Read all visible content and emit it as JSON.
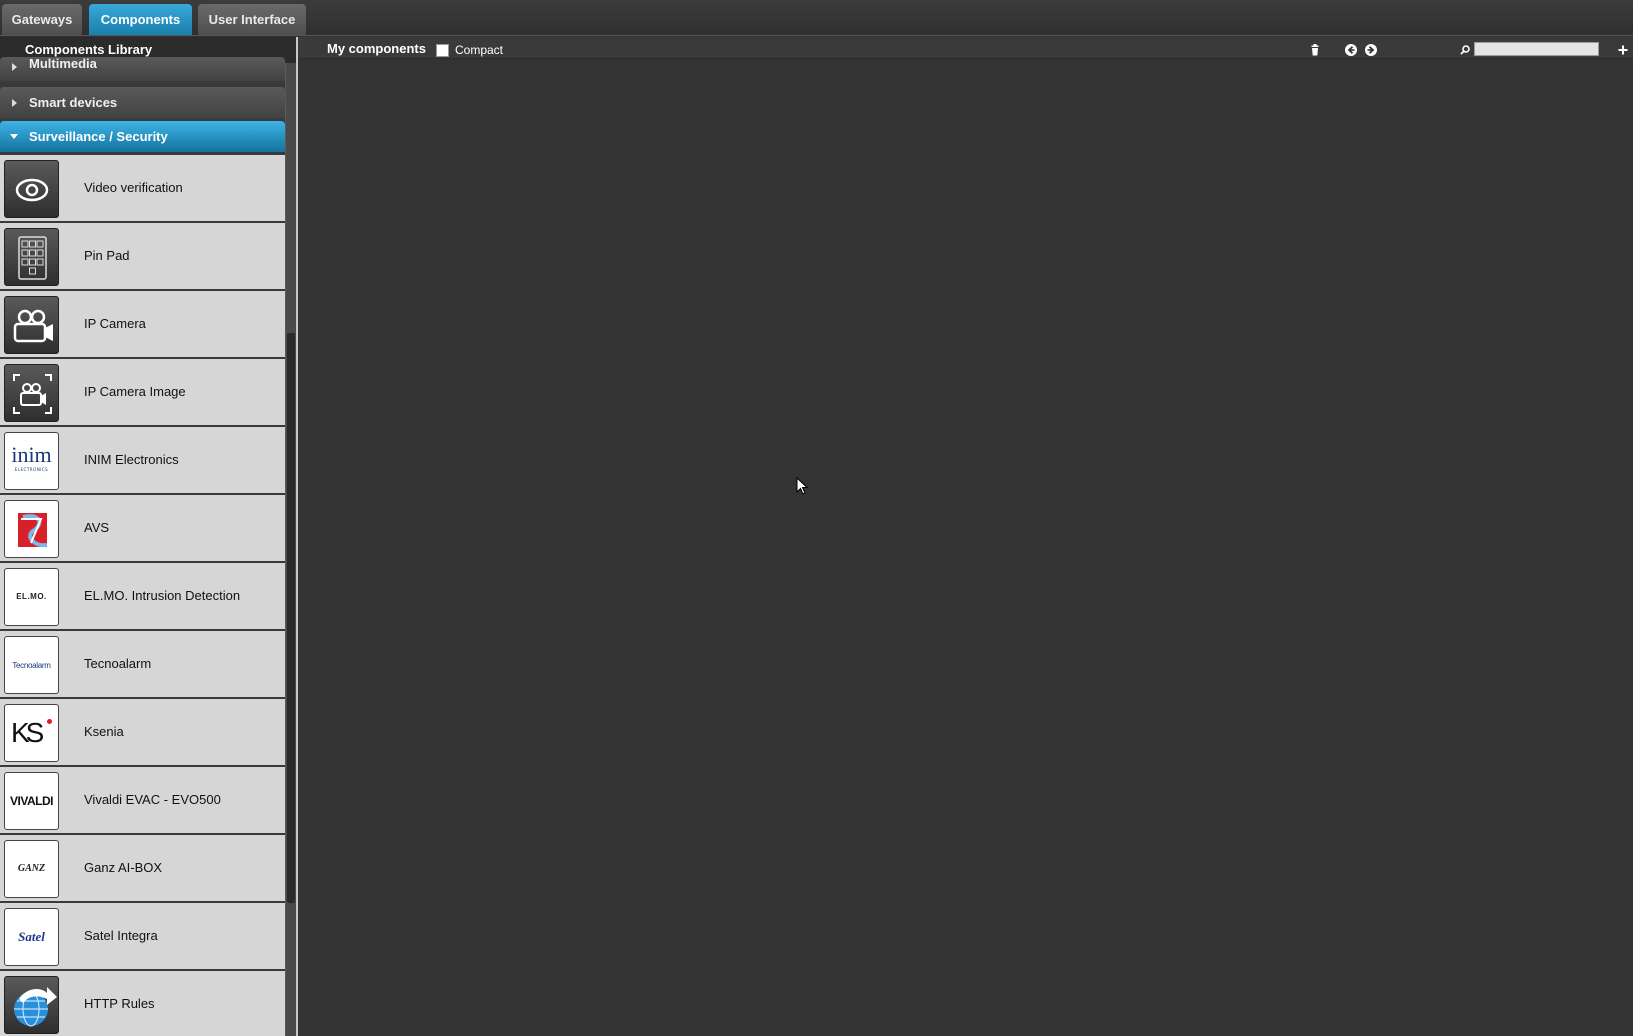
{
  "tabs": [
    {
      "label": "Gateways",
      "active": false
    },
    {
      "label": "Components",
      "active": true
    },
    {
      "label": "User Interface",
      "active": false
    }
  ],
  "sidebar": {
    "title": "Components Library",
    "categories": [
      {
        "label": "Multimedia",
        "open": false
      },
      {
        "label": "Smart devices",
        "open": false
      },
      {
        "label": "Surveillance / Security",
        "open": true
      }
    ],
    "items": [
      {
        "label": "Video verification",
        "icon": "eye-icon"
      },
      {
        "label": "Pin Pad",
        "icon": "keypad-icon"
      },
      {
        "label": "IP Camera",
        "icon": "camera-icon"
      },
      {
        "label": "IP Camera Image",
        "icon": "camera-image-icon"
      },
      {
        "label": "INIM Electronics",
        "icon": "inim-logo-icon"
      },
      {
        "label": "AVS",
        "icon": "avs-logo-icon"
      },
      {
        "label": "EL.MO. Intrusion Detection",
        "icon": "elmo-logo-icon"
      },
      {
        "label": "Tecnoalarm",
        "icon": "tecnoalarm-logo-icon"
      },
      {
        "label": "Ksenia",
        "icon": "ksenia-logo-icon"
      },
      {
        "label": "Vivaldi EVAC - EVO500",
        "icon": "vivaldi-logo-icon"
      },
      {
        "label": "Ganz AI-BOX",
        "icon": "ganz-logo-icon"
      },
      {
        "label": "Satel Integra",
        "icon": "satel-logo-icon"
      },
      {
        "label": "HTTP Rules",
        "icon": "http-globe-icon"
      }
    ],
    "logo_text": {
      "inim": "inim",
      "inim_sub": "ELECTRONICS",
      "elmo": "EL.MO.",
      "tecnoalarm": "Tecnoalarm",
      "ksenia": "KS",
      "vivaldi": "VIVALDI",
      "ganz": "GANZ",
      "satel": "Satel"
    }
  },
  "main": {
    "title": "My components",
    "compact_label": "Compact",
    "compact_checked": false,
    "search_value": ""
  },
  "colors": {
    "accent": "#1a8fc4",
    "background": "#333333"
  }
}
